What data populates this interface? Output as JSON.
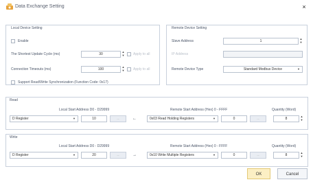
{
  "window": {
    "title": "Data Exchange Setting",
    "close_glyph": "×",
    "icon": "app-gear-icon"
  },
  "local": {
    "group_title": "Local Device Setting",
    "enable_label": "Enable",
    "cycle_label": "The Shortest Update Cycle (ms)",
    "cycle_value": "30",
    "cycle_apply": "Apply to all",
    "timeout_label": "Connection Timeouts (ms)",
    "timeout_value": "100",
    "timeout_apply": "Apply to all",
    "sync_label": "Support Read/Write Synchronization (Function Code: 0x17)"
  },
  "remote": {
    "group_title": "Remote Device Setting",
    "slave_label": "Slave Address",
    "slave_value": "1",
    "ip_label": "IP Address",
    "ip_value": "",
    "type_label": "Remote Device Type",
    "type_value": "Standard Modbus Device"
  },
  "read": {
    "group_title": "Read",
    "local_header": "Local Start Address D0 - D29999",
    "remote_header": "Remote Start Address (Hex) 0 - FFFF",
    "qty_header": "Quantity (Word)",
    "register": "D Register",
    "local_value": "10",
    "remote_func": "0x03 Read Holding Registers",
    "remote_value": "0",
    "qty_value": "8",
    "arrow": "←",
    "btn_glyph": "..."
  },
  "write": {
    "group_title": "Write",
    "local_header": "Local Start Address D0 - D29999",
    "remote_header": "Remote Start Address (Hex) 0 - FFFF",
    "qty_header": "Quantity (Word)",
    "register": "D Register",
    "local_value": "20",
    "remote_func": "0x10 Write Multiple Registers",
    "remote_value": "0",
    "qty_value": "8",
    "arrow": "→",
    "btn_glyph": "..."
  },
  "footer": {
    "ok_label": "OK",
    "cancel_label": "Cancel"
  },
  "glyphs": {
    "spin_up": "▲",
    "spin_down": "▼",
    "dropdown": "▼"
  },
  "colors": {
    "accent_ok": "#fcefc4",
    "border": "#c8d0dc",
    "title_text": "#5a6170",
    "icon_orange": "#e8a33c"
  }
}
